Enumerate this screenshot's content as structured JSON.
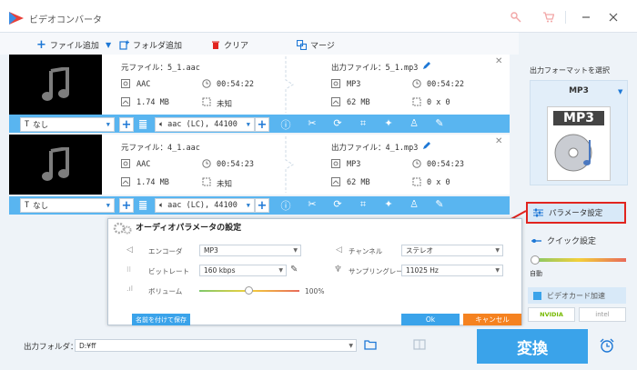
{
  "app": {
    "title": "ビデオコンバータ"
  },
  "toolbar": {
    "add_file": "ファイル追加",
    "add_folder": "フォルダ追加",
    "clear": "クリア",
    "merge": "マージ"
  },
  "files": [
    {
      "source": "元ファイル：5_1.aac",
      "format": "AAC",
      "duration": "00:54:22",
      "size": "1.74 MB",
      "resolution": "未知",
      "output": "出力ファイル：5_1.mp3",
      "out_format": "MP3",
      "out_duration": "00:54:22",
      "out_size": "62 MB",
      "out_resolution": "0 x 0",
      "subtitle": "なし",
      "audio": "aac (LC), 44100"
    },
    {
      "source": "元ファイル：4_1.aac",
      "format": "AAC",
      "duration": "00:54:23",
      "size": "1.74 MB",
      "resolution": "未知",
      "output": "出力ファイル：4_1.mp3",
      "out_format": "MP3",
      "out_duration": "00:54:23",
      "out_size": "62 MB",
      "out_resolution": "0 x 0",
      "subtitle": "なし",
      "audio": "aac (LC), 44100"
    }
  ],
  "right_panel": {
    "format_label": "出力フォーマットを選択",
    "format_name": "MP3",
    "format_icon_text": "MP3",
    "param_settings": "パラメータ設定",
    "quick_settings": "クイック設定",
    "auto_label": "自動",
    "gpu_accel": "ビデオカード加速",
    "nvidia": "NVIDIA",
    "intel": "intel"
  },
  "dialog": {
    "title": "オーディオパラメータの設定",
    "encoder_label": "エンコーダ",
    "encoder_value": "MP3",
    "channel_label": "チャンネル",
    "channel_value": "ステレオ",
    "bitrate_label": "ビットレート",
    "bitrate_value": "160 kbps",
    "samplerate_label": "サンプリングレート",
    "samplerate_value": "11025 Hz",
    "volume_label": "ボリューム",
    "volume_value": "100%",
    "volume_level": 0.5,
    "save_as": "名前を付けて保存",
    "ok": "Ok",
    "cancel": "キャンセル"
  },
  "bottom": {
    "output_folder_label": "出力フォルダ：",
    "output_folder_value": "D:¥ff",
    "convert": "変換"
  },
  "colors": {
    "accent_blue": "#59b5f0",
    "convert_blue": "#3aa3ea",
    "highlight_red": "#e1241f",
    "cancel_orange": "#f58220"
  }
}
